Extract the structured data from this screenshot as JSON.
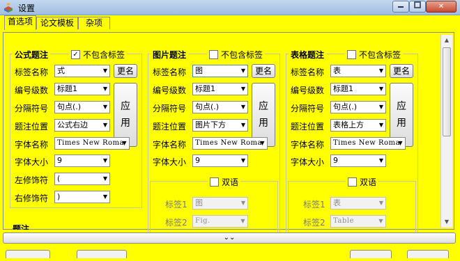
{
  "window": {
    "title": "设置",
    "close_label": "✕"
  },
  "tabs": [
    "首选项",
    "论文模板",
    "杂项"
  ],
  "labels": {
    "label_name": "标签名称",
    "numbering": "编号级数",
    "separator": "分隔符号",
    "caption_pos": "题注位置",
    "font_name": "字体名称",
    "font_size": "字体大小",
    "left_mod": "左修饰符",
    "right_mod": "右修饰符",
    "tag1": "标签1",
    "tag2": "标签2"
  },
  "buttons": {
    "rename": "更名",
    "apply_1": "应",
    "apply_2": "用"
  },
  "formula": {
    "title": "公式题注",
    "exclude_label": "不包含标签",
    "exclude_checked": true,
    "label_value": "式",
    "numbering_value": "标题1",
    "separator_value": "句点(.)",
    "position_value": "公式右边",
    "font_value": "Times New Roma",
    "size_value": "9",
    "left_value": "(",
    "right_value": ")"
  },
  "figure": {
    "title": "图片题注",
    "exclude_label": "不包含标签",
    "exclude_checked": false,
    "label_value": "图",
    "numbering_value": "标题1",
    "separator_value": "句点(.)",
    "position_value": "图片下方",
    "font_value": "Times New Roma",
    "size_value": "9",
    "bilingual_label": "双语",
    "bilingual_checked": false,
    "tag1_value": "图",
    "tag2_value": "Fig."
  },
  "table": {
    "title": "表格题注",
    "exclude_label": "不包含标签",
    "exclude_checked": false,
    "label_value": "表",
    "numbering_value": "标题1",
    "separator_value": "句点(.)",
    "position_value": "表格上方",
    "font_value": "Times New Roma",
    "size_value": "9",
    "bilingual_label": "双语",
    "bilingual_checked": false,
    "tag1_value": "表",
    "tag2_value": "Table"
  },
  "bottom": {
    "expand_glyph": "⌄⌄",
    "cut_label": "题注"
  },
  "colors": {
    "panel_bg": "#ffff00",
    "titlebar": "#b5cce8",
    "close_button": "#c64a32"
  },
  "icons": {
    "app": "settings-app-icon",
    "collapse": "chevron-double-down-icon"
  }
}
